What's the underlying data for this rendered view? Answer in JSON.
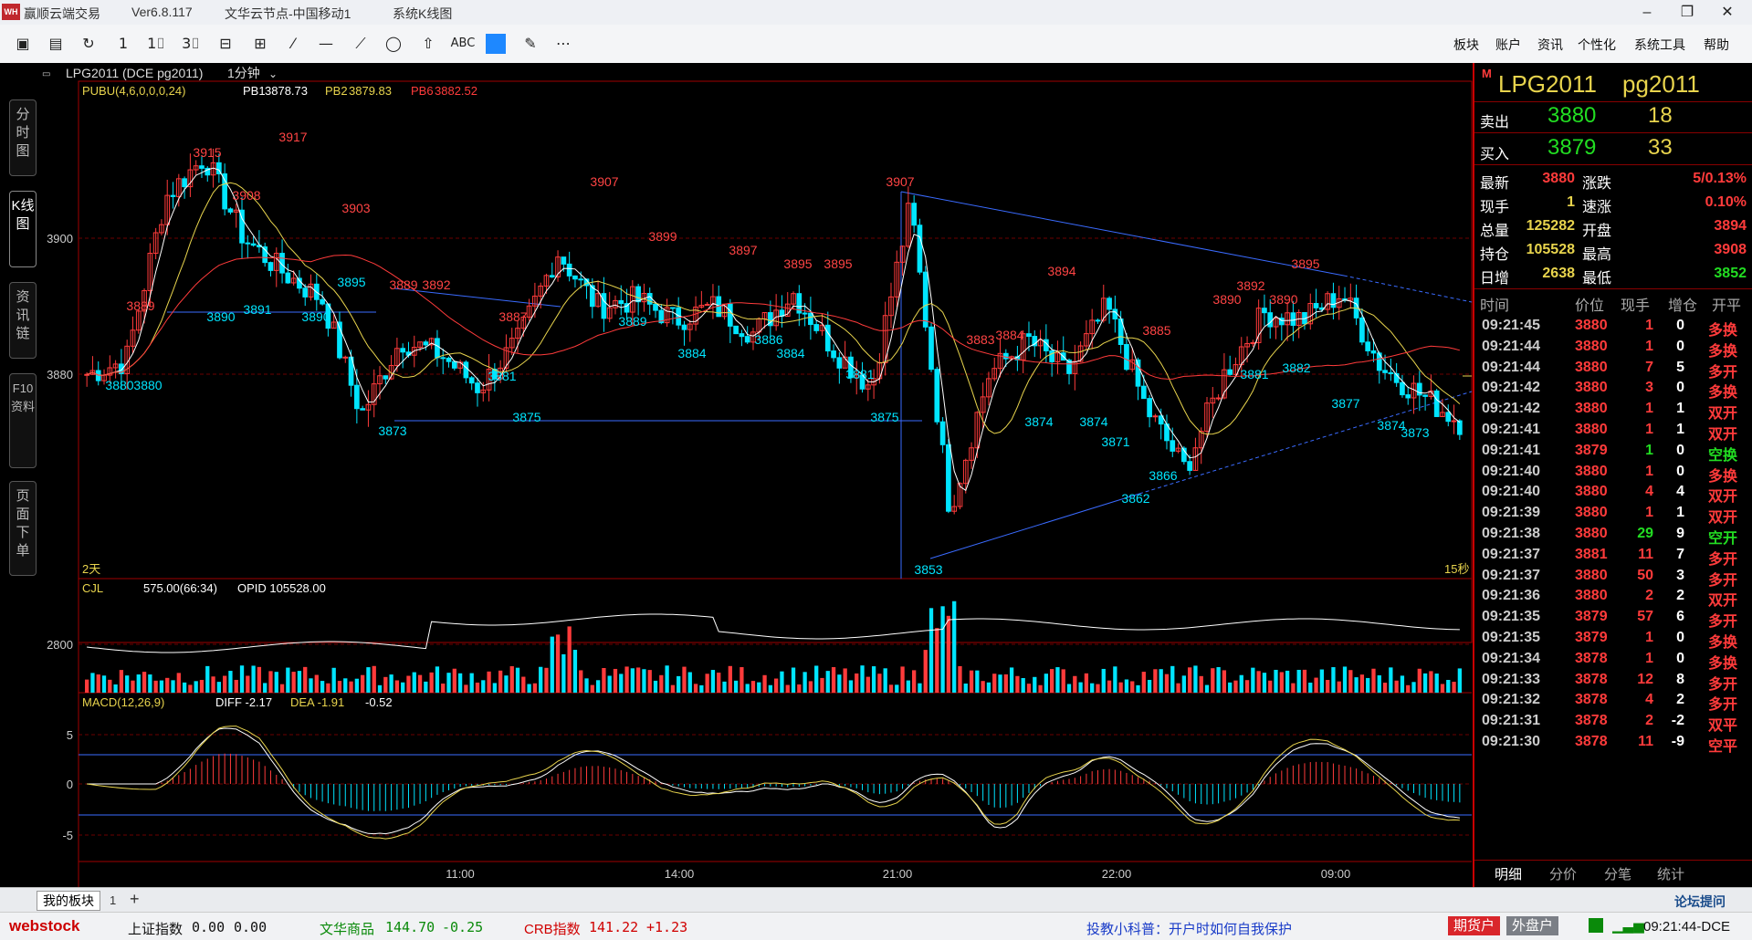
{
  "titlebar": {
    "app_name": "赢顺云端交易",
    "version": "Ver6.8.117",
    "node": "文华云节点-中国移动1",
    "view": "系统K线图",
    "logo": "WH"
  },
  "toolbar": {
    "icons": [
      "layout-icon",
      "save-icon",
      "refresh-icon",
      "cursor-icon",
      "bar-icon",
      "candle-icon",
      "period-icon",
      "split-icon",
      "line-tool-icon",
      "hline-tool-icon",
      "ray-tool-icon",
      "ellipse-tool-icon",
      "arrow-tool-icon",
      "text-tool-icon",
      "color-icon",
      "eraser-icon",
      "more-icon"
    ],
    "tb_glyphs": {
      "t1": "▣",
      "t2": "▤",
      "t3": "↻",
      "t4": "1",
      "t5": "1⌷",
      "t6": "3⌷",
      "t7": "⊟",
      "t8": "⊞",
      "t9": "⁄",
      "t10": "—",
      "t11": "⟋",
      "t12": "◯",
      "t13": "⇧",
      "t14": "ABC",
      "t16": "✎",
      "t17": "⋯"
    },
    "menus": [
      "板块",
      "账户",
      "资讯",
      "个性化",
      "系统工具",
      "帮助"
    ]
  },
  "side_tabs": [
    "分时图",
    "K线图",
    "资讯链",
    "F10资料",
    "页面下单"
  ],
  "chart": {
    "header_symbol": "LPG2011 (DCE pg2011)",
    "period": "1分钟",
    "indicator_main": "PUBU(4,6,0,0,0,24)",
    "pb1_label": "PB1",
    "pb1": "3878.73",
    "pb2_label": "PB2",
    "pb2": "3879.83",
    "pb6_label": "PB6",
    "pb6": "3882.52",
    "price_axis": [
      "3900",
      "3880"
    ],
    "range_label": "2天",
    "right_label": "15秒",
    "vol_indicator": "CJL",
    "vol_value": "575.00(66:34)",
    "opid": "OPID 105528.00",
    "vol_axis": "2800",
    "macd_indicator": "MACD(12,26,9)",
    "diff": "DIFF -2.17",
    "dea": "DEA -1.91",
    "macd_val": "-0.52",
    "macd_axis": [
      "5",
      "0",
      "-5"
    ],
    "time_axis": [
      "11:00",
      "14:00",
      "21:00",
      "22:00",
      "09:00"
    ],
    "high_labels": [
      "3915",
      "3917",
      "3908",
      "3903",
      "3907",
      "3899",
      "3897",
      "3895",
      "3895",
      "3907",
      "3894",
      "3892",
      "3895",
      "3892",
      "3889",
      "3887",
      "3890",
      "3890",
      "3883",
      "3884",
      "3885",
      "3889"
    ],
    "low_labels": [
      "3880",
      "3880",
      "3890",
      "3891",
      "3890",
      "3895",
      "3873",
      "3875",
      "3881",
      "3889",
      "3884",
      "3886",
      "3884",
      "3881",
      "3875",
      "3853",
      "3874",
      "3874",
      "3871",
      "3866",
      "3862",
      "3881",
      "3882",
      "3877",
      "3874",
      "3873"
    ]
  },
  "chart_data": {
    "type": "candlestick",
    "symbol": "LPG2011",
    "close_samples": [
      3880,
      3882,
      3906,
      3912,
      3900,
      3895,
      3891,
      3874,
      3885,
      3883,
      3878,
      3885,
      3898,
      3890,
      3891,
      3888,
      3890,
      3886,
      3892,
      3884,
      3878,
      3905,
      3860,
      3880,
      3885,
      3880,
      3890,
      3875,
      3866,
      3880,
      3889,
      3888,
      3892,
      3881,
      3877,
      3873
    ],
    "volume_axis_tick": 2800,
    "macd": {
      "DIFF": -2.17,
      "DEA": -1.91,
      "MACD": -0.52,
      "axis_ticks": [
        5,
        0,
        -5
      ]
    }
  },
  "quote": {
    "symbol_cn": "LPG2011",
    "symbol_code": "pg2011",
    "m_badge": "M",
    "ask_label": "卖出",
    "ask_price": "3880",
    "ask_vol": "18",
    "bid_label": "买入",
    "bid_price": "3879",
    "bid_vol": "33",
    "stats": [
      {
        "l1": "最新",
        "v1": "3880",
        "l2": "涨跌",
        "v2": "5/0.13%"
      },
      {
        "l1": "现手",
        "v1": "1",
        "l2": "速涨",
        "v2": "0.10%"
      },
      {
        "l1": "总量",
        "v1": "125282",
        "l2": "开盘",
        "v2": "3894"
      },
      {
        "l1": "持仓",
        "v1": "105528",
        "l2": "最高",
        "v2": "3908"
      },
      {
        "l1": "日增",
        "v1": "2638",
        "l2": "最低",
        "v2": "3852"
      }
    ],
    "tick_headers": [
      "时间",
      "价位",
      "现手",
      "增仓",
      "开平"
    ],
    "ticks": [
      {
        "time": "09:21:45",
        "price": "3880",
        "qty": "1",
        "oi": "0",
        "type": "多换",
        "pc": "#ff3b3b",
        "qc": "#ff3b3b",
        "tc": "#ff3b3b"
      },
      {
        "time": "09:21:44",
        "price": "3880",
        "qty": "1",
        "oi": "0",
        "type": "多换",
        "pc": "#ff3b3b",
        "qc": "#ff3b3b",
        "tc": "#ff3b3b"
      },
      {
        "time": "09:21:44",
        "price": "3880",
        "qty": "7",
        "oi": "5",
        "type": "多开",
        "pc": "#ff3b3b",
        "qc": "#ff3b3b",
        "tc": "#ff3b3b"
      },
      {
        "time": "09:21:42",
        "price": "3880",
        "qty": "3",
        "oi": "0",
        "type": "多换",
        "pc": "#ff3b3b",
        "qc": "#ff3b3b",
        "tc": "#ff3b3b"
      },
      {
        "time": "09:21:42",
        "price": "3880",
        "qty": "1",
        "oi": "1",
        "type": "双开",
        "pc": "#ff3b3b",
        "qc": "#ff3b3b",
        "tc": "#ff3b3b"
      },
      {
        "time": "09:21:41",
        "price": "3880",
        "qty": "1",
        "oi": "1",
        "type": "双开",
        "pc": "#ff3b3b",
        "qc": "#ff3b3b",
        "tc": "#ff3b3b"
      },
      {
        "time": "09:21:41",
        "price": "3879",
        "qty": "1",
        "oi": "0",
        "type": "空换",
        "pc": "#ff3b3b",
        "qc": "#22dd22",
        "tc": "#22dd22"
      },
      {
        "time": "09:21:40",
        "price": "3880",
        "qty": "1",
        "oi": "0",
        "type": "多换",
        "pc": "#ff3b3b",
        "qc": "#ff3b3b",
        "tc": "#ff3b3b"
      },
      {
        "time": "09:21:40",
        "price": "3880",
        "qty": "4",
        "oi": "4",
        "type": "双开",
        "pc": "#ff3b3b",
        "qc": "#ff3b3b",
        "tc": "#ff3b3b"
      },
      {
        "time": "09:21:39",
        "price": "3880",
        "qty": "1",
        "oi": "1",
        "type": "双开",
        "pc": "#ff3b3b",
        "qc": "#ff3b3b",
        "tc": "#ff3b3b"
      },
      {
        "time": "09:21:38",
        "price": "3880",
        "qty": "29",
        "oi": "9",
        "type": "空开",
        "pc": "#ff3b3b",
        "qc": "#22dd22",
        "tc": "#22dd22"
      },
      {
        "time": "09:21:37",
        "price": "3881",
        "qty": "11",
        "oi": "7",
        "type": "多开",
        "pc": "#ff3b3b",
        "qc": "#ff3b3b",
        "tc": "#ff3b3b"
      },
      {
        "time": "09:21:37",
        "price": "3880",
        "qty": "50",
        "oi": "3",
        "type": "多开",
        "pc": "#ff3b3b",
        "qc": "#ff3b3b",
        "tc": "#ff3b3b"
      },
      {
        "time": "09:21:36",
        "price": "3880",
        "qty": "2",
        "oi": "2",
        "type": "双开",
        "pc": "#ff3b3b",
        "qc": "#ff3b3b",
        "tc": "#ff3b3b"
      },
      {
        "time": "09:21:35",
        "price": "3879",
        "qty": "57",
        "oi": "6",
        "type": "多开",
        "pc": "#ff3b3b",
        "qc": "#ff3b3b",
        "tc": "#ff3b3b"
      },
      {
        "time": "09:21:35",
        "price": "3879",
        "qty": "1",
        "oi": "0",
        "type": "多换",
        "pc": "#ff3b3b",
        "qc": "#ff3b3b",
        "tc": "#ff3b3b"
      },
      {
        "time": "09:21:34",
        "price": "3878",
        "qty": "1",
        "oi": "0",
        "type": "多换",
        "pc": "#ff3b3b",
        "qc": "#ff3b3b",
        "tc": "#ff3b3b"
      },
      {
        "time": "09:21:33",
        "price": "3878",
        "qty": "12",
        "oi": "8",
        "type": "多开",
        "pc": "#ff3b3b",
        "qc": "#ff3b3b",
        "tc": "#ff3b3b"
      },
      {
        "time": "09:21:32",
        "price": "3878",
        "qty": "4",
        "oi": "2",
        "type": "多开",
        "pc": "#ff3b3b",
        "qc": "#ff3b3b",
        "tc": "#ff3b3b"
      },
      {
        "time": "09:21:31",
        "price": "3878",
        "qty": "2",
        "oi": "-2",
        "type": "双平",
        "pc": "#ff3b3b",
        "qc": "#ff3b3b",
        "tc": "#ff3b3b"
      },
      {
        "time": "09:21:30",
        "price": "3878",
        "qty": "11",
        "oi": "-9",
        "type": "空平",
        "pc": "#ff3b3b",
        "qc": "#ff3b3b",
        "tc": "#ff3b3b"
      }
    ],
    "tabs": [
      "明细",
      "分价",
      "分笔",
      "统计"
    ]
  },
  "bottom": {
    "board_tab": "我的板块",
    "page_num": "1",
    "add": "+",
    "forum": "论坛提问"
  },
  "status": {
    "brand": "webstock",
    "idx1_name": "上证指数",
    "idx1_val": "0.00",
    "idx1_chg": "0.00",
    "idx2_name": "文华商品",
    "idx2_val": "144.70",
    "idx2_chg": "-0.25",
    "idx3_name": "CRB指数",
    "idx3_val": "141.22",
    "idx3_chg": "+1.23",
    "tip": "投教小科普：开户时如何自我保护",
    "btn1": "期货户",
    "btn2": "外盘户",
    "clock": "09:21:44-DCE"
  },
  "colors": {
    "up": "#ff3b3b",
    "down": "#00e5ff",
    "grid": "#7a0000",
    "label_gold": "#e8d44d",
    "select": "#2a6bff"
  }
}
